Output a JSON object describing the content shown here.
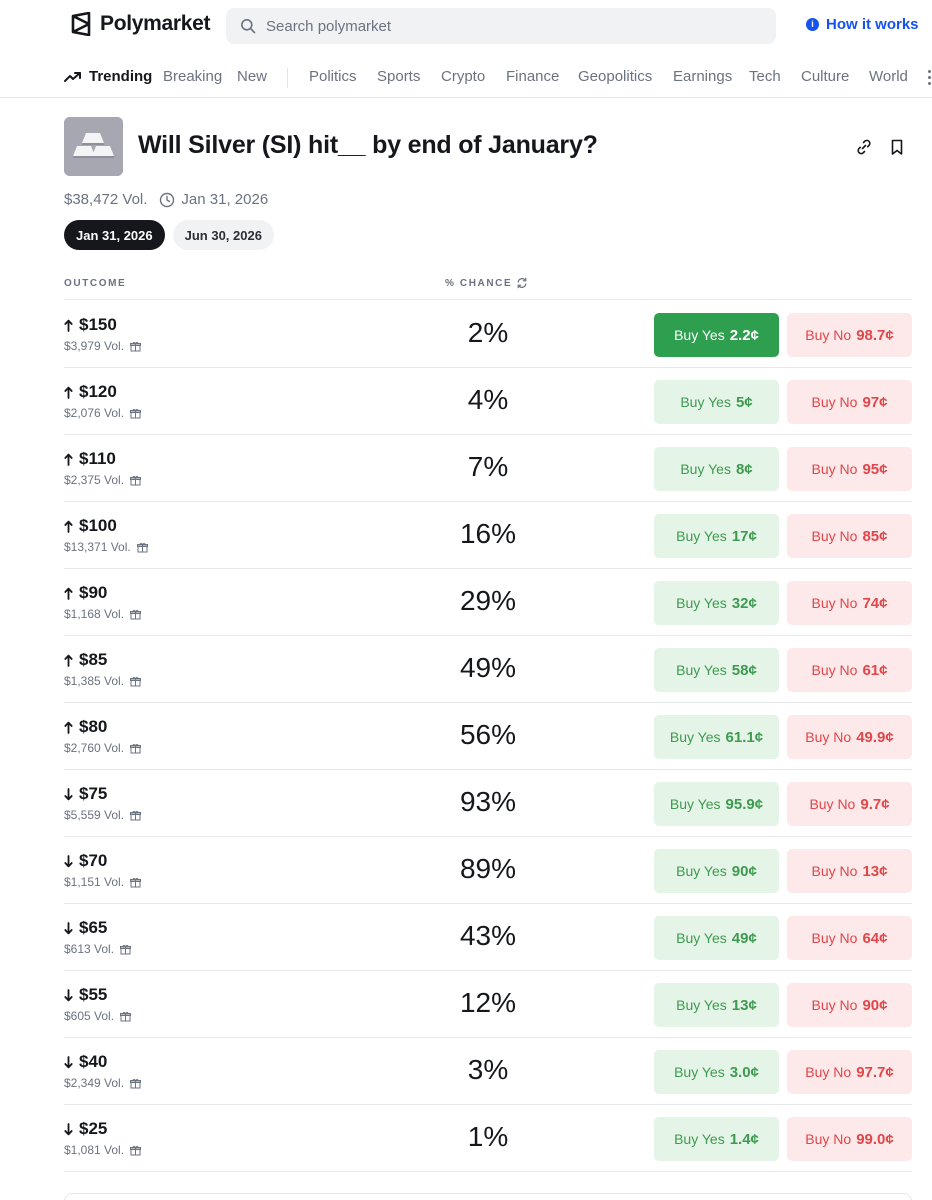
{
  "header": {
    "brand": "Polymarket",
    "search_placeholder": "Search polymarket",
    "how_it_works": "How it works"
  },
  "nav": {
    "active": "Trending",
    "primary": [
      "Breaking",
      "New"
    ],
    "categories": [
      "Politics",
      "Sports",
      "Crypto",
      "Finance",
      "Geopolitics",
      "Earnings",
      "Tech",
      "Culture",
      "World"
    ]
  },
  "market": {
    "title": "Will Silver (SI) hit__ by end of January?",
    "volume": "$38,472 Vol.",
    "end_date": "Jan 31, 2026",
    "date_tabs": [
      "Jan 31, 2026",
      "Jun 30, 2026"
    ]
  },
  "table": {
    "col_outcome": "OUTCOME",
    "col_chance": "% CHANCE",
    "yes_label": "Buy Yes",
    "no_label": "Buy No",
    "rows": [
      {
        "dir": "up",
        "strike": "$150",
        "vol": "$3,979 Vol.",
        "chance": "2%",
        "yes": "2.2¢",
        "no": "98.7¢"
      },
      {
        "dir": "up",
        "strike": "$120",
        "vol": "$2,076 Vol.",
        "chance": "4%",
        "yes": "5¢",
        "no": "97¢"
      },
      {
        "dir": "up",
        "strike": "$110",
        "vol": "$2,375 Vol.",
        "chance": "7%",
        "yes": "8¢",
        "no": "95¢"
      },
      {
        "dir": "up",
        "strike": "$100",
        "vol": "$13,371 Vol.",
        "chance": "16%",
        "yes": "17¢",
        "no": "85¢"
      },
      {
        "dir": "up",
        "strike": "$90",
        "vol": "$1,168 Vol.",
        "chance": "29%",
        "yes": "32¢",
        "no": "74¢"
      },
      {
        "dir": "up",
        "strike": "$85",
        "vol": "$1,385 Vol.",
        "chance": "49%",
        "yes": "58¢",
        "no": "61¢"
      },
      {
        "dir": "up",
        "strike": "$80",
        "vol": "$2,760 Vol.",
        "chance": "56%",
        "yes": "61.1¢",
        "no": "49.9¢"
      },
      {
        "dir": "down",
        "strike": "$75",
        "vol": "$5,559 Vol.",
        "chance": "93%",
        "yes": "95.9¢",
        "no": "9.7¢"
      },
      {
        "dir": "down",
        "strike": "$70",
        "vol": "$1,151 Vol.",
        "chance": "89%",
        "yes": "90¢",
        "no": "13¢"
      },
      {
        "dir": "down",
        "strike": "$65",
        "vol": "$613 Vol.",
        "chance": "43%",
        "yes": "49¢",
        "no": "64¢"
      },
      {
        "dir": "down",
        "strike": "$55",
        "vol": "$605 Vol.",
        "chance": "12%",
        "yes": "13¢",
        "no": "90¢"
      },
      {
        "dir": "down",
        "strike": "$40",
        "vol": "$2,349 Vol.",
        "chance": "3%",
        "yes": "3.0¢",
        "no": "97.7¢"
      },
      {
        "dir": "down",
        "strike": "$25",
        "vol": "$1,081 Vol.",
        "chance": "1%",
        "yes": "1.4¢",
        "no": "99.0¢"
      }
    ]
  },
  "colors": {
    "brand_blue": "#1652f0",
    "yes_green": "#3f9a51",
    "yes_bg": "#e4f4e6",
    "yes_filled": "#2e9e4f",
    "no_red": "#e0464a",
    "no_bg": "#fde9e9"
  },
  "icons": {
    "logo": "polymarket-logo-icon",
    "search": "search-icon",
    "info": "info-icon",
    "trending": "trending-icon",
    "link": "link-icon",
    "bookmark": "bookmark-icon",
    "clock": "clock-icon",
    "refresh": "refresh-icon",
    "gift": "gift-icon",
    "arrow_up": "arrow-up-icon",
    "arrow_down": "arrow-down-icon"
  }
}
